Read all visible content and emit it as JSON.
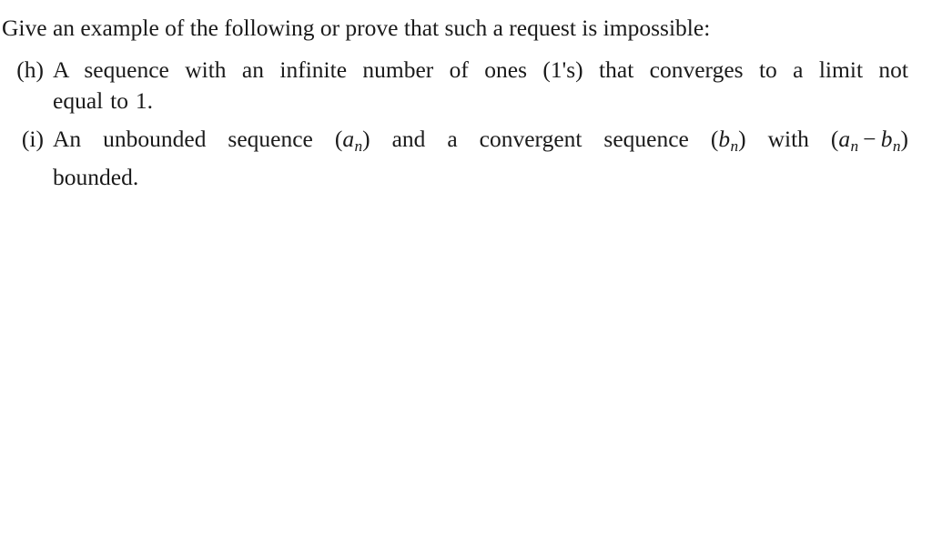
{
  "document": {
    "background_color": "#ffffff",
    "text_color": "#1a1a1a",
    "intro": "Give an example of the following or prove that such a request is impossible:",
    "items": [
      {
        "label": "(h)",
        "line1": "A sequence with an infinite number of ones (1's) that converges to a limit not",
        "line2": "equal to 1.",
        "full_text": "A sequence with an infinite number of ones (1's) that converges to a limit not equal to 1."
      },
      {
        "label": "(i)",
        "line1_part1": "An unbounded sequence",
        "line1_part2": "and a convergent sequence",
        "line1_part3": "with",
        "line2": "bounded.",
        "full_text": "An unbounded sequence (a_n) and a convergent sequence (b_n) with (a_n - b_n) bounded.",
        "math": {
          "a_n": {
            "open": "(",
            "var": "a",
            "sub": "n",
            "close": ")"
          },
          "b_n": {
            "open": "(",
            "var": "b",
            "sub": "n",
            "close": ")"
          },
          "a_minus_b": {
            "open": "(",
            "var1": "a",
            "sub1": "n",
            "op": "−",
            "var2": "b",
            "sub2": "n",
            "close": ")"
          }
        }
      }
    ]
  }
}
